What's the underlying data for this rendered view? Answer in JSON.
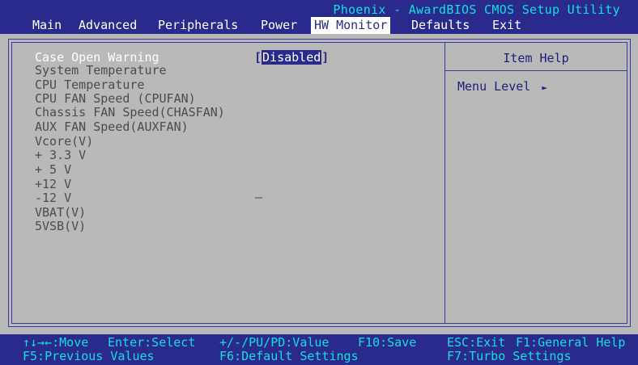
{
  "title": "Phoenix - AwardBIOS CMOS Setup Utility",
  "menu": [
    "Main",
    "Advanced",
    "Peripherals",
    "Power",
    "HW Monitor",
    "Defaults",
    "Exit"
  ],
  "active_menu": "HW Monitor",
  "items": {
    "case_open_warning": {
      "label": "Case Open Warning",
      "value": "Disabled"
    },
    "system_temperature": "System Temperature",
    "cpu_temperature": "CPU Temperature",
    "cpu_fan": "CPU FAN Speed (CPUFAN)",
    "chassis_fan": "Chassis FAN Speed(CHASFAN)",
    "aux_fan": "AUX FAN Speed(AUXFAN)",
    "vcore": "Vcore(V)",
    "v33": "+ 3.3 V",
    "v5": "+ 5 V",
    "v12": "+12 V",
    "vneg12": "-12 V",
    "vbat": "VBAT(V)",
    "v5vsb": "5VSB(V)"
  },
  "help": {
    "title": "Item Help",
    "menu_level": "Menu Level",
    "menu_level_arrow": "►"
  },
  "hints": {
    "move": "↑↓→←:Move",
    "select": "Enter:Select",
    "value": "+/-/PU/PD:Value",
    "save": "F10:Save",
    "exit": "ESC:Exit",
    "general_help": "F1:General Help",
    "previous": "F5:Previous Values",
    "default": "F6:Default Settings",
    "turbo": "F7:Turbo Settings"
  },
  "colors": {
    "background": "#b9b9b9",
    "bar": "#2a2a8c",
    "title": "#12e0e0",
    "text_white": "#ffffff",
    "text_gray": "#4c4c4c"
  }
}
